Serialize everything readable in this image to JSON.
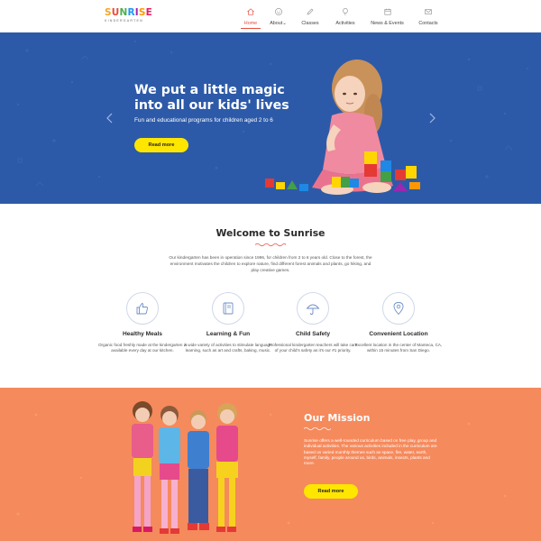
{
  "brand": {
    "name_letters": [
      "S",
      "U",
      "N",
      "R",
      "I",
      "S",
      "E"
    ],
    "letter_colors": [
      "#f5a623",
      "#e74c3c",
      "#4caf50",
      "#2196f3",
      "#9c27b0",
      "#ff9800",
      "#e91e63"
    ],
    "tagline": "KINDERGARTEN"
  },
  "nav": {
    "items": [
      {
        "label": "Home",
        "icon": "home-icon",
        "active": true
      },
      {
        "label": "About",
        "icon": "smiley-icon",
        "active": false
      },
      {
        "label": "Classes",
        "icon": "pencil-icon",
        "active": false
      },
      {
        "label": "Activities",
        "icon": "balloon-icon",
        "active": false
      },
      {
        "label": "News & Events",
        "icon": "calendar-icon",
        "active": false
      },
      {
        "label": "Contacts",
        "icon": "mail-icon",
        "active": false
      }
    ],
    "accent": "#e74c3c"
  },
  "hero": {
    "title_line1": "We put a little magic",
    "title_line2": "into all our kids' lives",
    "subtitle": "Fun and educational programs for children aged 2 to 6",
    "button": "Read more",
    "background": "#2d5aa8"
  },
  "welcome": {
    "title": "Welcome to Sunrise",
    "text": "Our kindergarten has been in operation since 1996, for children from 2 to 6 years old. Close to the forest, the environment motivates the children to explore nature, find different forest animals and plants, go hiking, and play creative games."
  },
  "features": [
    {
      "title": "Healthy Meals",
      "icon": "thumbs-up-icon",
      "text": "Organic food freshly made at the kindergarten is available every day at our kitchen."
    },
    {
      "title": "Learning & Fun",
      "icon": "book-icon",
      "text": "A wide variety of activities to stimulate language learning, such as art and crafts, baking, music."
    },
    {
      "title": "Child Safety",
      "icon": "umbrella-icon",
      "text": "Professional kindergarten teachers will take care of your child's safety as it's our #1 priority."
    },
    {
      "title": "Convenient Location",
      "icon": "map-pin-icon",
      "text": "Excellent location in the center of Manteca, CA, within 15 minutes from San Diego."
    }
  ],
  "mission": {
    "title": "Our Mission",
    "text": "Sunrise offers a well-rounded curriculum based on free play, group and individual activities. The various activities included in the curriculum are based on varied monthly themes such as space, fire, water, earth, myself, family, people around us, birds, animals, insects, plants and more.",
    "button": "Read more",
    "background": "#f58a5c"
  },
  "colors": {
    "button_yellow": "#ffe600",
    "hero_blue": "#2d5aa8",
    "mission_orange": "#f58a5c"
  }
}
